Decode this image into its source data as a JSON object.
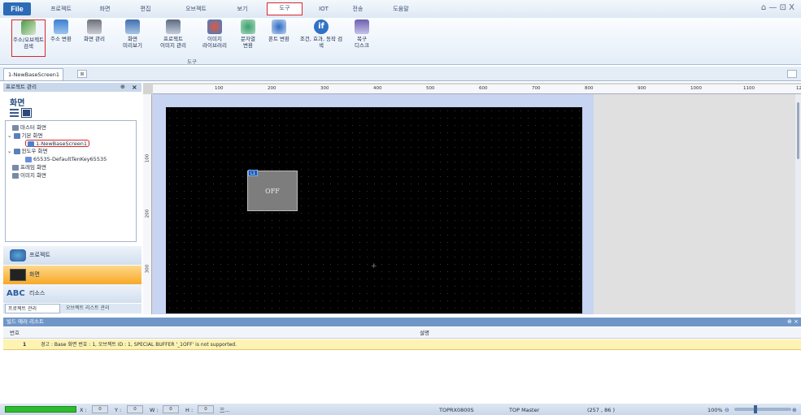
{
  "menubar": {
    "file": "File",
    "items": [
      "프로젝트",
      "화면",
      "편집",
      "오브젝트",
      "보기",
      "도구",
      "IOT",
      "전송",
      "도움말"
    ],
    "selected_index": 5,
    "window_controls": "⌂ — ⊡ X"
  },
  "ribbon": {
    "buttons": [
      {
        "label": "주소/오브젝트\n검색",
        "icon": "address-search-icon"
      },
      {
        "label": "주소 변환",
        "icon": "address-convert-icon"
      },
      {
        "label": "화면 관리",
        "icon": "screen-manage-icon"
      },
      {
        "label": "화면\n미리보기",
        "icon": "screen-preview-icon"
      },
      {
        "label": "프로젝트\n이미지 관리",
        "icon": "project-image-icon"
      },
      {
        "label": "이미지\n라이브러리",
        "icon": "image-library-icon"
      },
      {
        "label": "문자열\n변환",
        "icon": "string-convert-icon"
      },
      {
        "label": "폰트 변환",
        "icon": "font-convert-icon"
      },
      {
        "label": "조건, 효과, 동작 검\n색",
        "icon": "condition-search-icon"
      },
      {
        "label": "복구\n디스크",
        "icon": "recovery-disk-icon"
      }
    ],
    "group_label": "도구"
  },
  "doc_tab": {
    "label": "1-NewBaseScreen1"
  },
  "left_panel": {
    "header": "프로젝트 관리",
    "title": "화면",
    "tree": [
      "마스터 화면",
      "기본 화면",
      "1-NewBaseScreen1",
      "윈도우 화면",
      "65535-DefaultTenKey65535",
      "프레임 화면",
      "이미지 화면"
    ],
    "sections": [
      "프로젝트",
      "화면",
      "리소스"
    ],
    "bottom_tabs": [
      "프로젝트 관리",
      "오브젝트 리스트 관리"
    ]
  },
  "ruler": {
    "h_ticks": [
      "100",
      "200",
      "300",
      "400",
      "500",
      "600",
      "700",
      "800",
      "900",
      "1000",
      "1100",
      "1200"
    ],
    "v_ticks": [
      "100",
      "200",
      "300"
    ]
  },
  "canvas": {
    "lamp_text": "OFF",
    "lamp_tag": "L1"
  },
  "error_list": {
    "title": "빌드 에러 리스트",
    "col_no": "번호",
    "col_desc": "설명",
    "rows": [
      {
        "no": "1",
        "text": "경고 : Base 화면 번호 : 1, 오브젝트 ID : 1, SPECIAL BUFFER '_1OFF' is not supported."
      }
    ]
  },
  "statusbar": {
    "labels": [
      "X :",
      "Y :",
      "W :",
      "H :"
    ],
    "values": [
      "0",
      "0",
      "0",
      "0"
    ],
    "extra": "三...",
    "device": "TOPRX0800S",
    "app": "TOP Master",
    "coords": "(257 , 86 )",
    "zoom": "100%"
  },
  "colors": {
    "accent": "#2c6bb6",
    "highlight_red": "#d9262c",
    "warning_row": "#fff3b3",
    "progress_green": "#2fbb2f"
  }
}
